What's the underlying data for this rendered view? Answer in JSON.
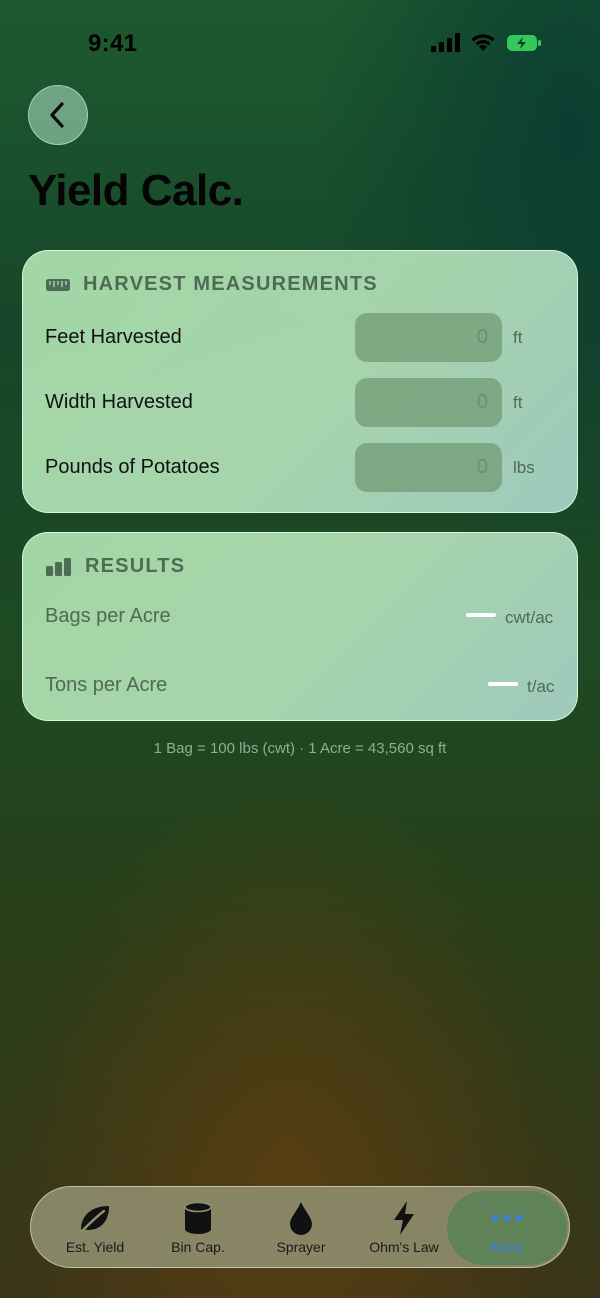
{
  "status_bar": {
    "time": "9:41"
  },
  "nav": {
    "back_icon": "chevron-left-icon"
  },
  "page": {
    "title": "Yield Calc."
  },
  "measurements": {
    "title": "HARVEST MEASUREMENTS",
    "icon": "ruler-icon",
    "rows": [
      {
        "label": "Feet Harvested",
        "value": "0",
        "unit": "ft"
      },
      {
        "label": "Width Harvested",
        "value": "0",
        "unit": "ft"
      },
      {
        "label": "Pounds of Potatoes",
        "value": "0",
        "unit": "lbs"
      }
    ]
  },
  "results": {
    "title": "RESULTS",
    "icon": "bar-chart-icon",
    "rows": [
      {
        "label": "Bags per Acre",
        "unit": "cwt/ac"
      },
      {
        "label": "Tons per Acre",
        "unit": "t/ac"
      }
    ]
  },
  "footnote": "1 Bag = 100 lbs (cwt) · 1 Acre = 43,560 sq ft",
  "tabs": [
    {
      "label": "Est. Yield",
      "icon": "leaf-icon"
    },
    {
      "label": "Bin Cap.",
      "icon": "cylinder-icon"
    },
    {
      "label": "Sprayer",
      "icon": "drop-icon"
    },
    {
      "label": "Ohm's Law",
      "icon": "bolt-icon"
    },
    {
      "label": "More",
      "icon": "ellipsis-icon"
    }
  ],
  "colors": {
    "accent": "#3a82e0",
    "battery": "#34c759"
  }
}
